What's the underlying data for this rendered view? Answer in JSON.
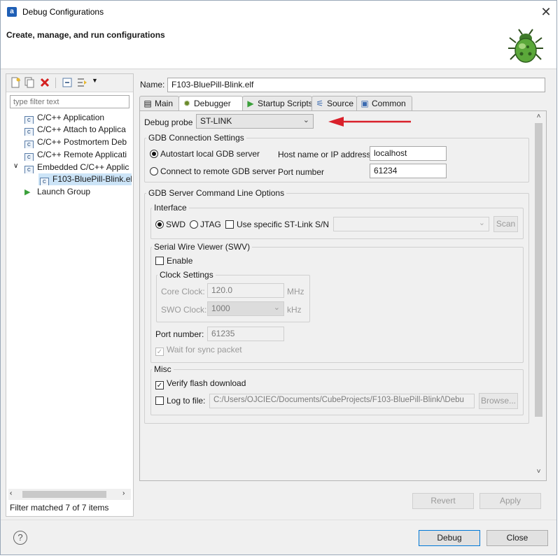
{
  "window": {
    "title": "Debug Configurations",
    "close_glyph": "✕"
  },
  "header": {
    "title": "Create, manage, and run configurations"
  },
  "left": {
    "filter_placeholder": "type filter text",
    "tree": [
      {
        "label": "C/C++ Application",
        "icon": "c-config-icon"
      },
      {
        "label": "C/C++ Attach to Applica",
        "icon": "c-config-icon"
      },
      {
        "label": "C/C++ Postmortem Deb",
        "icon": "c-config-icon"
      },
      {
        "label": "C/C++ Remote Applicati",
        "icon": "c-config-icon"
      },
      {
        "label": "Embedded C/C++ Applic",
        "icon": "c-config-icon",
        "expanded": true
      },
      {
        "label": "F103-BluePill-Blink.elf",
        "icon": "c-config-icon",
        "selected": true
      },
      {
        "label": "Launch Group",
        "icon": "launch-group-icon"
      }
    ],
    "status": "Filter matched 7 of 7 items"
  },
  "name": {
    "label": "Name:",
    "value": "F103-BluePill-Blink.elf"
  },
  "tabs": [
    "Main",
    "Debugger",
    "Startup Scripts",
    "Source",
    "Common"
  ],
  "debugger": {
    "probe_label": "Debug probe",
    "probe_value": "ST-LINK",
    "gdb_connection": {
      "title": "GDB Connection Settings",
      "autostart": "Autostart local GDB server",
      "remote": "Connect to remote GDB server",
      "host_label": "Host name or IP address",
      "host_value": "localhost",
      "port_label": "Port number",
      "port_value": "61234"
    },
    "server_options": {
      "title": "GDB Server Command Line Options",
      "interface_title": "Interface",
      "swd": "SWD",
      "jtag": "JTAG",
      "specific_sn": "Use specific ST-Link S/N",
      "scan": "Scan"
    },
    "swv": {
      "title": "Serial Wire Viewer (SWV)",
      "enable": "Enable",
      "clock_title": "Clock Settings",
      "core_clock_label": "Core Clock:",
      "core_clock_value": "120.0",
      "core_clock_unit": "MHz",
      "swo_clock_label": "SWO Clock:",
      "swo_clock_value": "1000",
      "swo_clock_unit": "kHz",
      "port_label": "Port number:",
      "port_value": "61235",
      "wait_sync": "Wait for sync packet"
    },
    "misc": {
      "title": "Misc",
      "verify_flash": "Verify flash download",
      "log_to_file": "Log to file:",
      "log_path": "C:/Users/OJCIEC/Documents/CubeProjects/F103-BluePill-Blink/\\Debu",
      "browse": "Browse..."
    }
  },
  "buttons": {
    "revert": "Revert",
    "apply": "Apply",
    "debug": "Debug",
    "close": "Close",
    "help": "?"
  },
  "colors": {
    "annotation_arrow": "#d9202a",
    "selection": "#cce4f7"
  }
}
